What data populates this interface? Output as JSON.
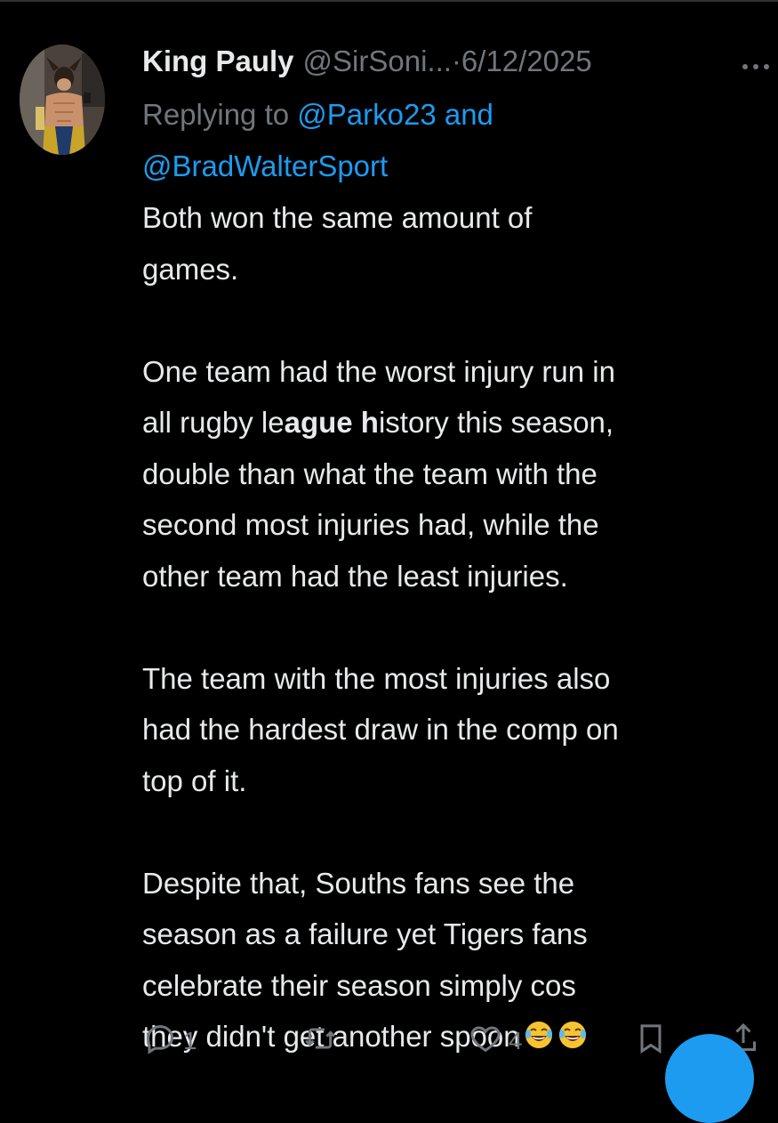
{
  "tweet": {
    "display_name": "King Pauly",
    "handle": "@SirSoni...",
    "separator": "·",
    "date": "6/12/2025",
    "replying_prefix": "Replying to ",
    "reply_mention_1": "@Parko23",
    "reply_connector": " and",
    "reply_mention_2": "@BradWalterSport",
    "paragraphs": {
      "p1_line1": "Both won the same amount of",
      "p1_line2": "games.",
      "p2_before_bold_1": "One team had the worst injury run in",
      "p2_line2_a": "all rugby le",
      "p2_line2_bold_1": "ague h",
      "p2_line2_b": "istory this season,",
      "p2_line3": "double than what the team with the",
      "p2_line4": "second most injuries had, while the",
      "p2_line5": "other team had the least injuries.",
      "p3_line1": "The team with the most injuries also",
      "p3_line2": "had the hardest draw in the comp on",
      "p3_line3": "top of it.",
      "p4_line1": "Despite that, Souths fans see the",
      "p4_line2": "season as a failure yet Tigers fans",
      "p4_line3": "celebrate their season simply cos",
      "p4_line4": "they didn't get another spoon"
    },
    "emojis": [
      "face-with-tears-of-joy",
      "face-with-tears-of-joy"
    ]
  },
  "actions": {
    "reply_count": "1",
    "like_count": "4"
  },
  "icons": {
    "more": "more-horizontal-icon",
    "reply": "reply-icon",
    "retweet": "retweet-icon",
    "like": "heart-icon",
    "bookmark": "bookmark-icon",
    "share": "share-icon"
  },
  "colors": {
    "background": "#000000",
    "text": "#e7e9ea",
    "muted": "#71767b",
    "link": "#1d9bf0"
  }
}
